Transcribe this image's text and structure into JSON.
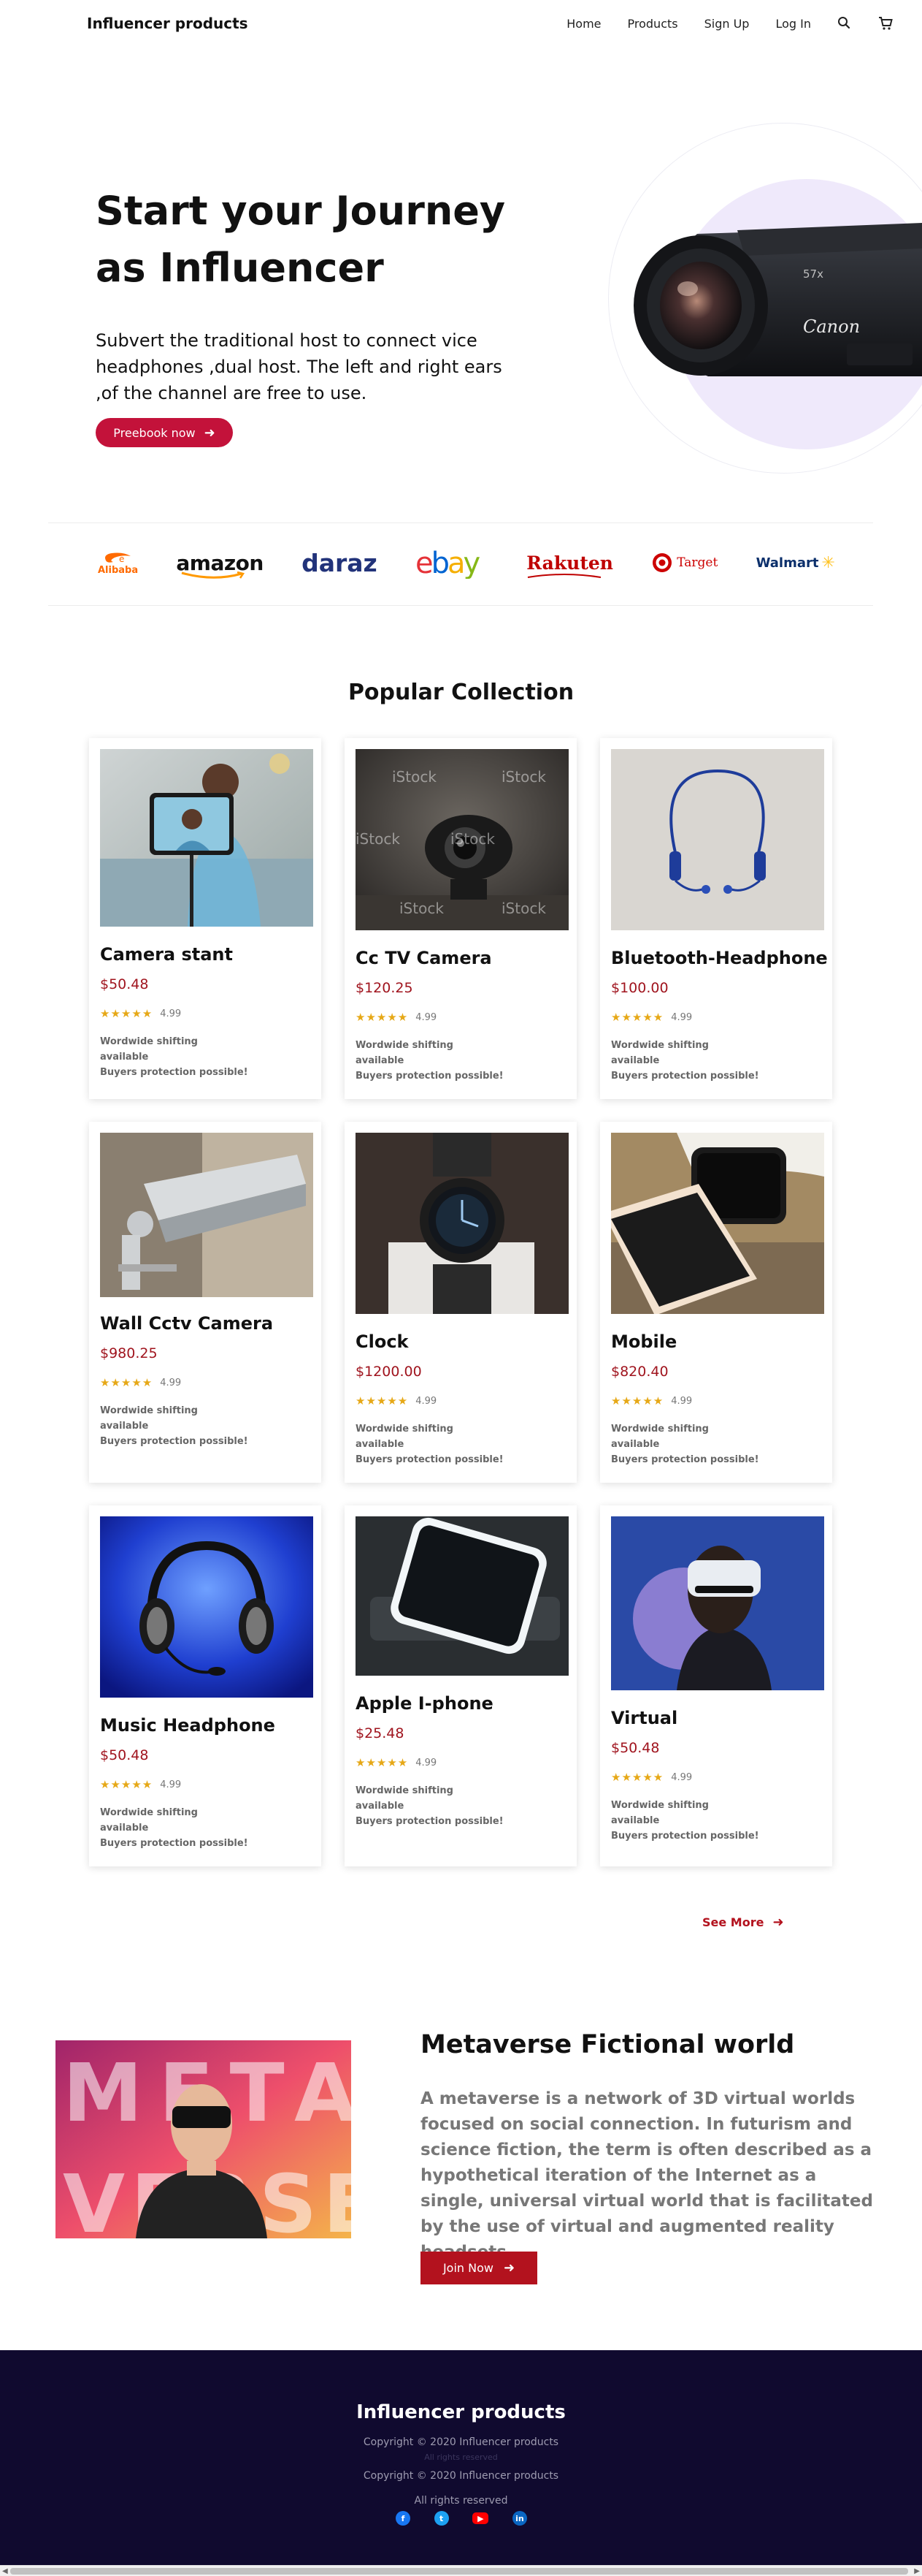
{
  "nav": {
    "brand": "Influencer products",
    "links": [
      "Home",
      "Products",
      "Sign Up",
      "Log In"
    ],
    "icons": [
      "search-icon",
      "cart-icon"
    ]
  },
  "hero": {
    "title": "Start your Journey as Influencer",
    "subtitle": "Subvert the traditional host to connect vice headphones ,dual host. The left and right ears ,of the channel are free to use.",
    "button_label": "Preebook now",
    "image_brand_text": "Canon",
    "image_model_text": "57x",
    "accent": "#c3123a"
  },
  "partners": [
    "Alibaba",
    "amazon",
    "daraz",
    "ebay",
    "Rakuten",
    "Target",
    "Walmart"
  ],
  "popular": {
    "title": "Popular Collection",
    "products": [
      {
        "name": "Camera stant",
        "price": "$50.48",
        "rating": "4.99",
        "stars": "★★★★★",
        "info": [
          "Wordwide shifting",
          "available",
          "Buyers protection possible!"
        ]
      },
      {
        "name": "Cc TV Camera",
        "price": "$120.25",
        "rating": "4.99",
        "stars": "★★★★★",
        "info": [
          "Wordwide shifting",
          "available",
          "Buyers protection possible!"
        ]
      },
      {
        "name": "Bluetooth-Headphone",
        "price": "$100.00",
        "rating": "4.99",
        "stars": "★★★★★",
        "info": [
          "Wordwide shifting",
          "available",
          "Buyers protection possible!"
        ]
      },
      {
        "name": "Wall Cctv Camera",
        "price": "$980.25",
        "rating": "4.99",
        "stars": "★★★★★",
        "info": [
          "Wordwide shifting",
          "available",
          "Buyers protection possible!"
        ]
      },
      {
        "name": "Clock",
        "price": "$1200.00",
        "rating": "4.99",
        "stars": "★★★★★",
        "info": [
          "Wordwide shifting",
          "available",
          "Buyers protection possible!"
        ]
      },
      {
        "name": "Mobile",
        "price": "$820.40",
        "rating": "4.99",
        "stars": "★★★★★",
        "info": [
          "Wordwide shifting",
          "available",
          "Buyers protection possible!"
        ]
      },
      {
        "name": "Music Headphone",
        "price": "$50.48",
        "rating": "4.99",
        "stars": "★★★★★",
        "info": [
          "Wordwide shifting",
          "available",
          "Buyers protection possible!"
        ]
      },
      {
        "name": "Apple I-phone",
        "price": "$25.48",
        "rating": "4.99",
        "stars": "★★★★★",
        "info": [
          "Wordwide shifting",
          "available",
          "Buyers protection possible!"
        ]
      },
      {
        "name": "Virtual",
        "price": "$50.48",
        "rating": "4.99",
        "stars": "★★★★★",
        "info": [
          "Wordwide shifting",
          "available",
          "Buyers protection possible!"
        ]
      }
    ],
    "watermark": "iStock",
    "see_more": "See More",
    "price_color": "#a0141e"
  },
  "metaverse": {
    "title": "Metaverse Fictional world",
    "text": "A metaverse is a network of 3D virtual worlds focused on social connection. In futurism and science fiction, the term is often described as a hypothetical iteration of the Internet as a single, universal virtual world that is facilitated by the use of virtual and augmented reality headsets.",
    "button_label": "Join Now",
    "image_letters_top": "META",
    "image_letters_bottom": "VERSE"
  },
  "footer": {
    "brand": "Influencer products",
    "lines": [
      "Copyright © 2020 Influencer products",
      "All rights reserved",
      "Copyright © 2020 Influencer products",
      "All rights reserved"
    ],
    "social": [
      {
        "icon": "facebook-icon",
        "glyph": "f",
        "color": "#1877f2"
      },
      {
        "icon": "twitter-icon",
        "glyph": "t",
        "color": "#1da1f2"
      },
      {
        "icon": "youtube-icon",
        "glyph": "▶",
        "color": "#ff0000"
      },
      {
        "icon": "linkedin-icon",
        "glyph": "in",
        "color": "#0a66c2"
      }
    ],
    "background": "#100a2f"
  }
}
